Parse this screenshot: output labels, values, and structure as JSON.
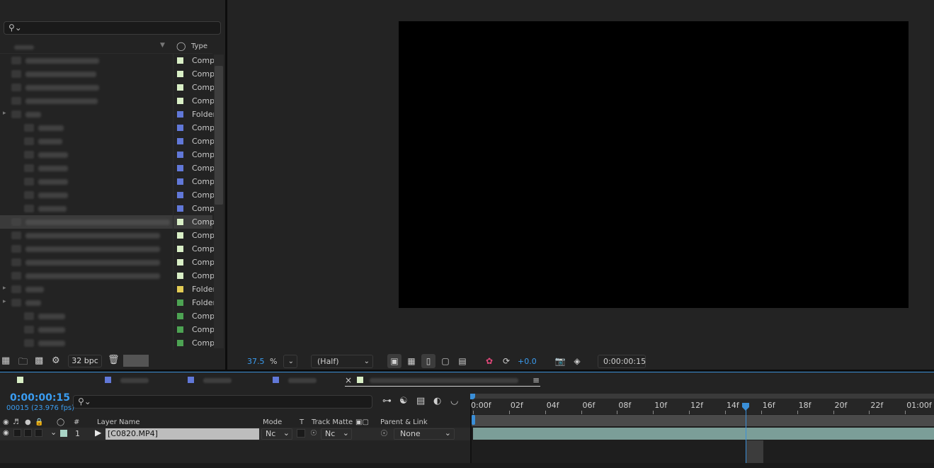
{
  "project_panel": {
    "search_placeholder": "",
    "columns": {
      "type": "Type"
    },
    "rows": [
      {
        "type": "Comp",
        "color": "#d9efc6",
        "indent": 0,
        "kind": "comp"
      },
      {
        "type": "Comp",
        "color": "#d9efc6",
        "indent": 0,
        "kind": "comp"
      },
      {
        "type": "Comp",
        "color": "#d9efc6",
        "indent": 0,
        "kind": "comp"
      },
      {
        "type": "Comp",
        "color": "#d9efc6",
        "indent": 0,
        "kind": "comp"
      },
      {
        "type": "Folder",
        "color": "#6178d8",
        "indent": 0,
        "kind": "folder"
      },
      {
        "type": "Comp",
        "color": "#6178d8",
        "indent": 1,
        "kind": "comp"
      },
      {
        "type": "Comp",
        "color": "#6178d8",
        "indent": 1,
        "kind": "comp"
      },
      {
        "type": "Comp",
        "color": "#6178d8",
        "indent": 1,
        "kind": "comp"
      },
      {
        "type": "Comp",
        "color": "#6178d8",
        "indent": 1,
        "kind": "comp"
      },
      {
        "type": "Comp",
        "color": "#6178d8",
        "indent": 1,
        "kind": "comp"
      },
      {
        "type": "Comp",
        "color": "#6178d8",
        "indent": 1,
        "kind": "comp"
      },
      {
        "type": "Comp",
        "color": "#6178d8",
        "indent": 1,
        "kind": "comp"
      },
      {
        "type": "Comp",
        "color": "#d9efc6",
        "indent": 0,
        "kind": "comp",
        "selected": true
      },
      {
        "type": "Comp",
        "color": "#d9efc6",
        "indent": 0,
        "kind": "comp"
      },
      {
        "type": "Comp",
        "color": "#d9efc6",
        "indent": 0,
        "kind": "comp"
      },
      {
        "type": "Comp",
        "color": "#d9efc6",
        "indent": 0,
        "kind": "comp"
      },
      {
        "type": "Comp",
        "color": "#d9efc6",
        "indent": 0,
        "kind": "comp"
      },
      {
        "type": "Folder",
        "color": "#e3cc55",
        "indent": 0,
        "kind": "folder"
      },
      {
        "type": "Folder",
        "color": "#4da353",
        "indent": 0,
        "kind": "folder"
      },
      {
        "type": "Comp",
        "color": "#4da353",
        "indent": 1,
        "kind": "comp"
      },
      {
        "type": "Comp",
        "color": "#4da353",
        "indent": 1,
        "kind": "comp"
      },
      {
        "type": "Comp",
        "color": "#4da353",
        "indent": 1,
        "kind": "comp"
      }
    ],
    "footer": {
      "bpc": "32 bpc"
    }
  },
  "viewer": {
    "zoom_value": "37.5",
    "zoom_unit": "%",
    "resolution": "(Half)",
    "exposure": "+0.0",
    "current_time": "0:00:00:15"
  },
  "timeline": {
    "tabs": [
      {
        "color": "#d9efc6"
      },
      {
        "color": "#6178d8"
      },
      {
        "color": "#6178d8"
      },
      {
        "color": "#6178d8"
      }
    ],
    "active_tab": {
      "close": "×",
      "color": "#d9efc6",
      "menu": "≡"
    },
    "timecode": "0:00:00:15",
    "frame_info": "00015 (23.976 fps)",
    "columns": {
      "number": "#",
      "layer_name": "Layer Name",
      "mode": "Mode",
      "t": "T",
      "track_matte": "Track Matte",
      "parent_link": "Parent & Link"
    },
    "layers": [
      {
        "number": "1",
        "name": "[C0820.MP4]",
        "label_color": "#a8d3c5",
        "mode": "Nc",
        "track_matte": "Nc",
        "parent": "None"
      }
    ],
    "ruler_labels": [
      "0:00f",
      "02f",
      "04f",
      "06f",
      "08f",
      "10f",
      "12f",
      "14f",
      "16f",
      "18f",
      "20f",
      "22f",
      "01:00f"
    ],
    "playhead_frame": 15,
    "clip_color": "#7b9e98",
    "accent_color": "#3a9cf0"
  }
}
